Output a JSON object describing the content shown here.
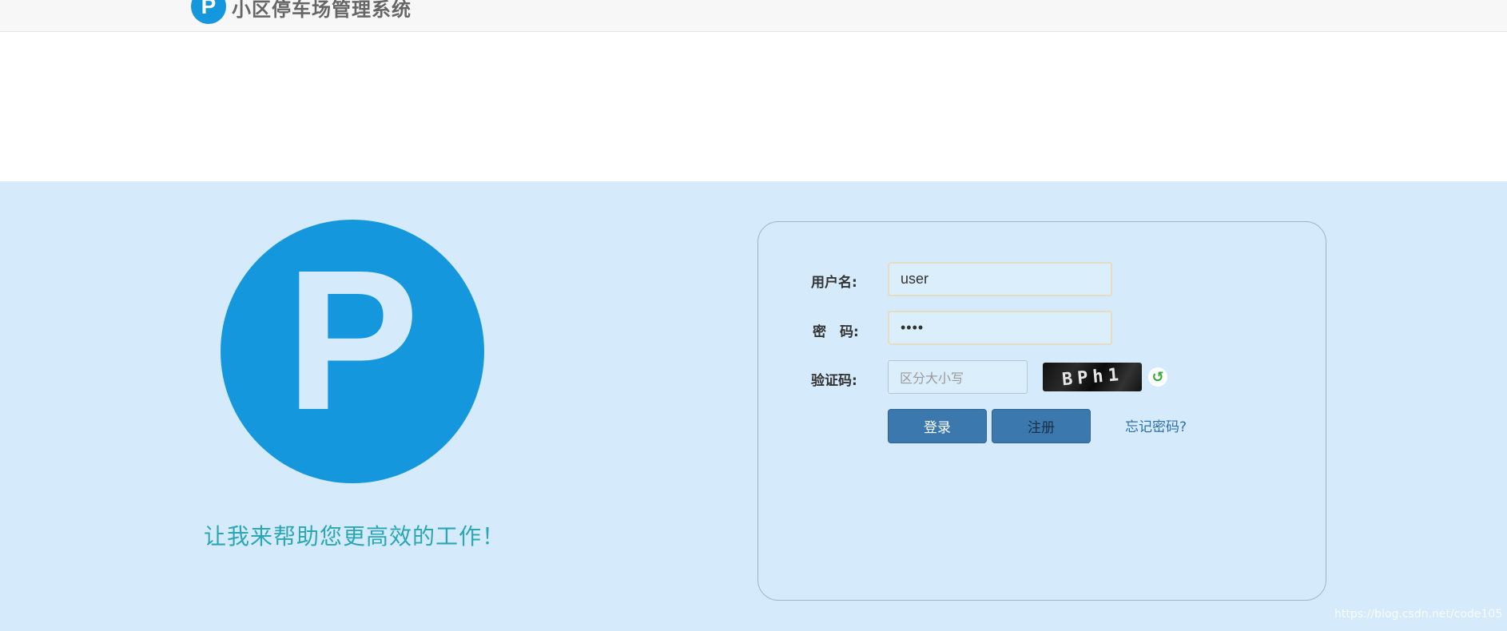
{
  "header": {
    "logo_letter": "P",
    "title": "小区停车场管理系统"
  },
  "hero": {
    "logo_letter": "P",
    "slogan": "让我来帮助您更高效的工作！"
  },
  "login": {
    "username_label": "用户名:",
    "username_value": "user",
    "password_label": "密　码:",
    "password_value": "••••",
    "captcha_label": "验证码:",
    "captcha_placeholder": "区分大小写",
    "captcha_text": "BPh1",
    "refresh_glyph": "↺",
    "login_button": "登录",
    "register_button": "注册",
    "forgot_link": "忘记密码?"
  },
  "watermark": "https://blog.csdn.net/code105",
  "colors": {
    "brand_blue": "#1497dc",
    "panel_bg": "#d5ebfb",
    "button_blue": "#3a78ad",
    "slogan_teal": "#2aa6b5"
  }
}
